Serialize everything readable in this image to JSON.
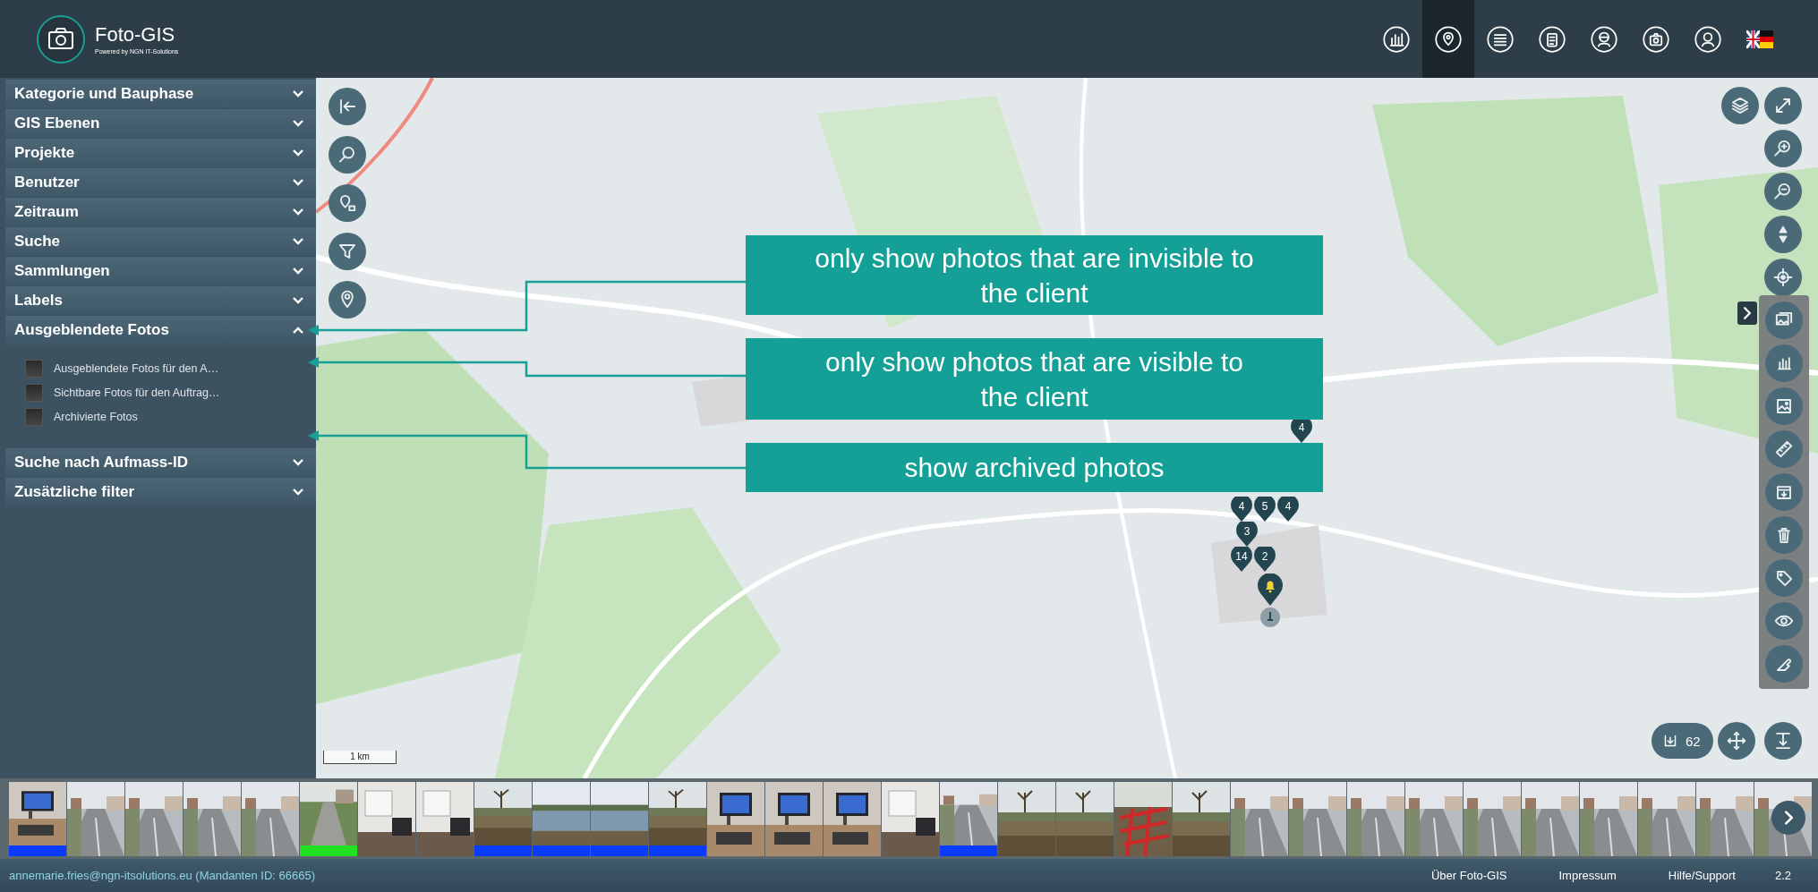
{
  "header": {
    "title": "Foto-GIS",
    "subtitle": "Powered by NGN IT-Solutions",
    "nav": [
      {
        "kind": "chart",
        "selected": false
      },
      {
        "kind": "map",
        "selected": true
      },
      {
        "kind": "list",
        "selected": false
      },
      {
        "kind": "clipboard",
        "selected": false
      },
      {
        "kind": "mask",
        "selected": false
      },
      {
        "kind": "camera",
        "selected": false
      },
      {
        "kind": "user",
        "selected": false
      },
      {
        "kind": "flag",
        "selected": false
      }
    ]
  },
  "sidebar": {
    "sections": [
      {
        "label": "Kategorie und Bauphase",
        "expanded": false
      },
      {
        "label": "GIS Ebenen",
        "expanded": false
      },
      {
        "label": "Projekte",
        "expanded": false
      },
      {
        "label": "Benutzer",
        "expanded": false
      },
      {
        "label": "Zeitraum",
        "expanded": false
      },
      {
        "label": "Suche",
        "expanded": false
      },
      {
        "label": "Sammlungen",
        "expanded": false
      },
      {
        "label": "Labels",
        "expanded": false
      },
      {
        "label": "Ausgeblendete Fotos",
        "expanded": true,
        "options": [
          {
            "label": "Ausgeblendete Fotos für den A…",
            "checked": false
          },
          {
            "label": "Sichtbare Fotos für den Auftrag…",
            "checked": false
          },
          {
            "label": "Archivierte Fotos",
            "checked": false
          }
        ]
      },
      {
        "label": "Suche nach Aufmass-ID",
        "expanded": false
      },
      {
        "label": "Zusätzliche filter",
        "expanded": false
      }
    ]
  },
  "map": {
    "markers": [
      {
        "label": "4"
      },
      {
        "label": "4"
      },
      {
        "label": "5"
      },
      {
        "label": "4"
      },
      {
        "label": "3"
      },
      {
        "label": "14"
      },
      {
        "label": "2"
      }
    ],
    "scale": "1 km",
    "photo_count": "62",
    "annotations": [
      {
        "text": "only show photos that are invisible to the client"
      },
      {
        "text": "only show photos that are visible to the client"
      },
      {
        "text": "show archived photos"
      }
    ]
  },
  "footer": {
    "user": "annemarie.fries@ngn-itsolutions.eu (Mandanten ID: 66665)",
    "links": [
      "Über Foto-GIS",
      "Impressum",
      "Hilfe/Support"
    ],
    "version": "2.2"
  }
}
